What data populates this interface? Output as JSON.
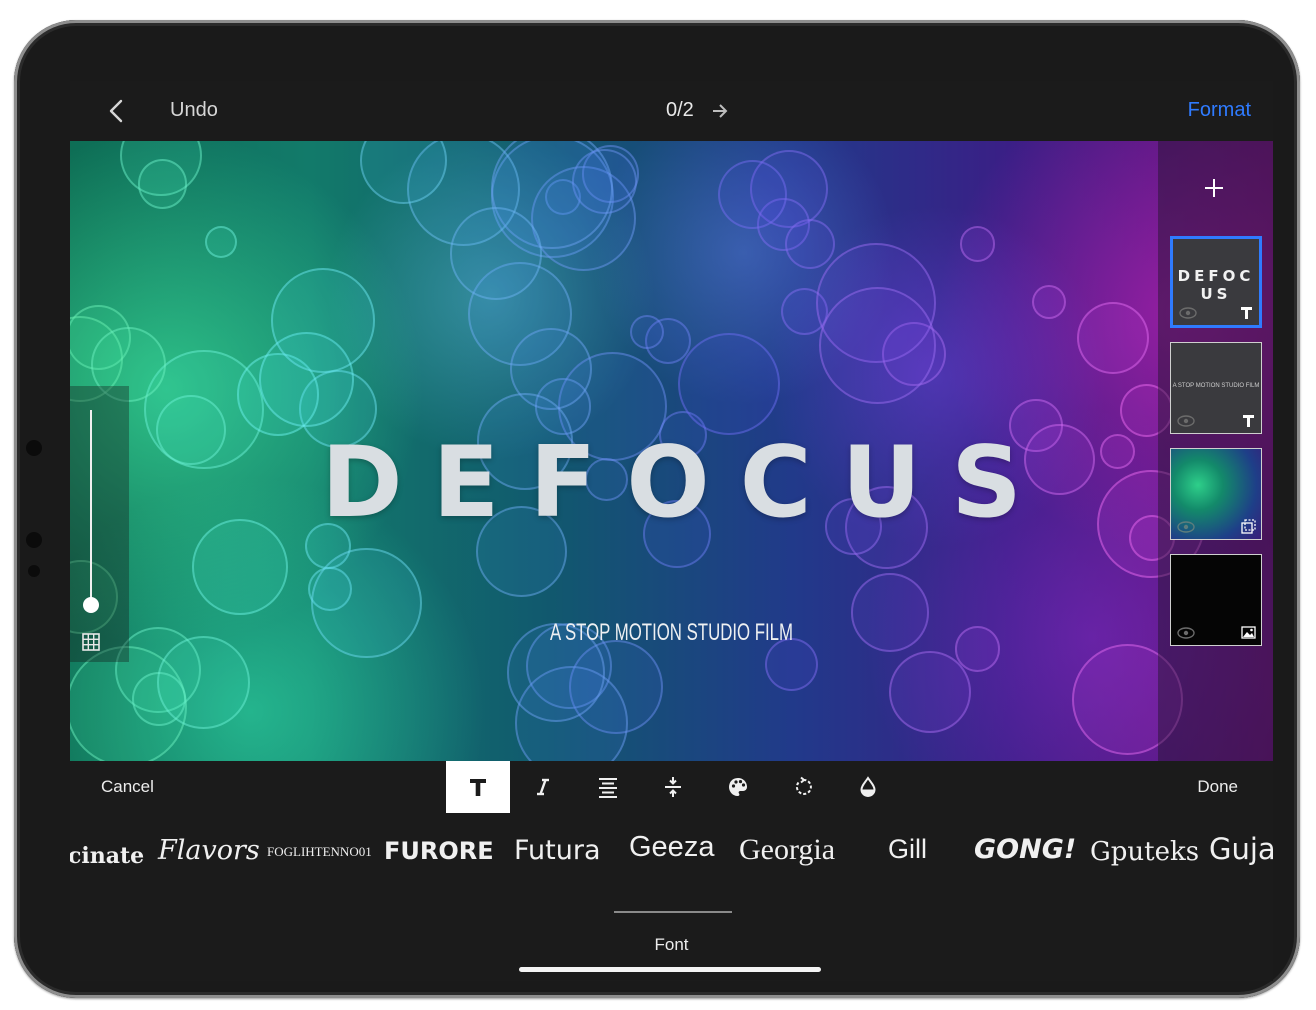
{
  "topbar": {
    "undo_label": "Undo",
    "counter": "0/2",
    "format_label": "Format"
  },
  "canvas": {
    "title": "DEFOCUS",
    "subtitle": "A STOP MOTION STUDIO FILM"
  },
  "layers": [
    {
      "text": "DEFOC US",
      "type": "text",
      "selected": true
    },
    {
      "text": "A STOP MOTION STUDIO FILM",
      "type": "text",
      "selected": false
    },
    {
      "text": "",
      "type": "background",
      "selected": false
    },
    {
      "text": "",
      "type": "image",
      "selected": false
    }
  ],
  "toolbar": {
    "cancel_label": "Cancel",
    "done_label": "Done",
    "tools": [
      "font-tool",
      "italic-tool",
      "align-tool",
      "spacing-tool",
      "color-palette-tool",
      "rotate-tool",
      "opacity-tool"
    ],
    "active_tool": "font-tool"
  },
  "fonts": {
    "items": [
      "cinate",
      "Flavors",
      "FOGLIHTENNO01",
      "FURORE",
      "Futura",
      "Geeza",
      "Georgia",
      "Gill",
      "GONG!",
      "Gputeks",
      "Guja"
    ],
    "selected": "Geeza",
    "label": "Font"
  },
  "colors": {
    "accent": "#2f7bff",
    "background": "#1b1b1b"
  }
}
